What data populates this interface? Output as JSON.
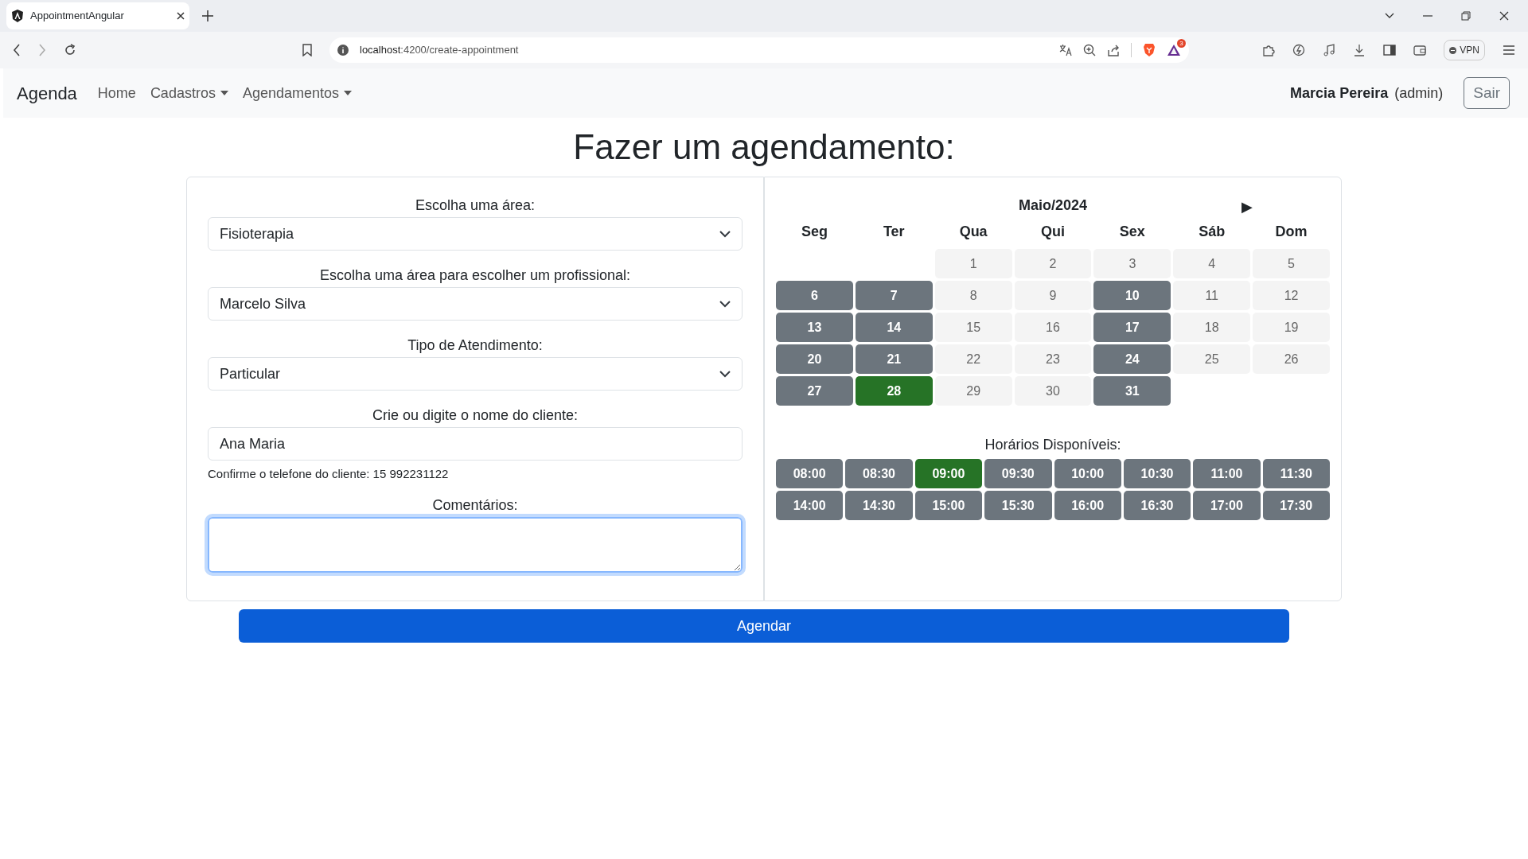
{
  "browser": {
    "tab_title": "AppointmentAngular",
    "url_host": "localhost",
    "url_path": ":4200/create-appointment",
    "rewards_badge": "3",
    "vpn_label": "VPN"
  },
  "navbar": {
    "brand": "Agenda",
    "links": [
      {
        "label": "Home",
        "dropdown": false
      },
      {
        "label": "Cadastros",
        "dropdown": true
      },
      {
        "label": "Agendamentos",
        "dropdown": true
      }
    ],
    "user_name": "Marcia Pereira",
    "user_role": "(admin)",
    "logout": "Sair"
  },
  "heading": "Fazer um agendamento:",
  "form": {
    "fields": [
      {
        "kind": "select",
        "label": "Escolha uma área:",
        "value": "Fisioterapia"
      },
      {
        "kind": "select",
        "label": "Escolha uma área para escolher um profissional:",
        "value": "Marcelo Silva"
      },
      {
        "kind": "select",
        "label": "Tipo de Atendimento:",
        "value": "Particular"
      },
      {
        "kind": "input",
        "label": "Crie ou digite o nome do cliente:",
        "value": "Ana Maria",
        "hint": "Confirme o telefone do cliente: 15 992231122"
      },
      {
        "kind": "textarea",
        "label": "Comentários:",
        "focused": true
      }
    ]
  },
  "calendar": {
    "month": "Maio/2024",
    "next": "▶",
    "weekdays": [
      "Seg",
      "Ter",
      "Qua",
      "Qui",
      "Sex",
      "Sáb",
      "Dom"
    ],
    "weeks": [
      [
        {
          "day": "1",
          "available": false,
          "selected": false
        },
        {
          "day": "2",
          "available": false,
          "selected": false
        },
        {
          "day": "3",
          "available": false,
          "selected": false
        },
        {
          "day": "4",
          "available": false,
          "selected": false
        },
        {
          "day": "5",
          "available": false,
          "selected": false
        }
      ],
      [
        {
          "day": "6",
          "available": true,
          "selected": false
        },
        {
          "day": "7",
          "available": true,
          "selected": false
        },
        {
          "day": "8",
          "available": false,
          "selected": false
        },
        {
          "day": "9",
          "available": false,
          "selected": false
        },
        {
          "day": "10",
          "available": true,
          "selected": false
        },
        {
          "day": "11",
          "available": false,
          "selected": false
        },
        {
          "day": "12",
          "available": false,
          "selected": false
        }
      ],
      [
        {
          "day": "13",
          "available": true,
          "selected": false
        },
        {
          "day": "14",
          "available": true,
          "selected": false
        },
        {
          "day": "15",
          "available": false,
          "selected": false
        },
        {
          "day": "16",
          "available": false,
          "selected": false
        },
        {
          "day": "17",
          "available": true,
          "selected": false
        },
        {
          "day": "18",
          "available": false,
          "selected": false
        },
        {
          "day": "19",
          "available": false,
          "selected": false
        }
      ],
      [
        {
          "day": "20",
          "available": true,
          "selected": false
        },
        {
          "day": "21",
          "available": true,
          "selected": false
        },
        {
          "day": "22",
          "available": false,
          "selected": false
        },
        {
          "day": "23",
          "available": false,
          "selected": false
        },
        {
          "day": "24",
          "available": true,
          "selected": false
        },
        {
          "day": "25",
          "available": false,
          "selected": false
        },
        {
          "day": "26",
          "available": false,
          "selected": false
        }
      ],
      [
        {
          "day": "27",
          "available": true,
          "selected": false
        },
        {
          "day": "28",
          "selected": true
        },
        {
          "day": "29",
          "available": false,
          "selected": false
        },
        {
          "day": "30",
          "available": false,
          "selected": false
        },
        {
          "day": "31",
          "available": true,
          "selected": false
        }
      ]
    ],
    "times_label": "Horários Disponíveis:",
    "times": [
      {
        "time": "08:00",
        "selected": false
      },
      {
        "time": "08:30",
        "selected": false
      },
      {
        "time": "09:00",
        "selected": true
      },
      {
        "time": "09:30",
        "selected": false
      },
      {
        "time": "10:00",
        "selected": false
      },
      {
        "time": "10:30",
        "selected": false
      },
      {
        "time": "11:00",
        "selected": false
      },
      {
        "time": "11:30",
        "selected": false
      },
      {
        "time": "14:00",
        "selected": false
      },
      {
        "time": "14:30",
        "selected": false
      },
      {
        "time": "15:00",
        "selected": false
      },
      {
        "time": "15:30",
        "selected": false
      },
      {
        "time": "16:00",
        "selected": false
      },
      {
        "time": "16:30",
        "selected": false
      },
      {
        "time": "17:00",
        "selected": false
      },
      {
        "time": "17:30",
        "selected": false
      }
    ]
  },
  "submit": "Agendar"
}
